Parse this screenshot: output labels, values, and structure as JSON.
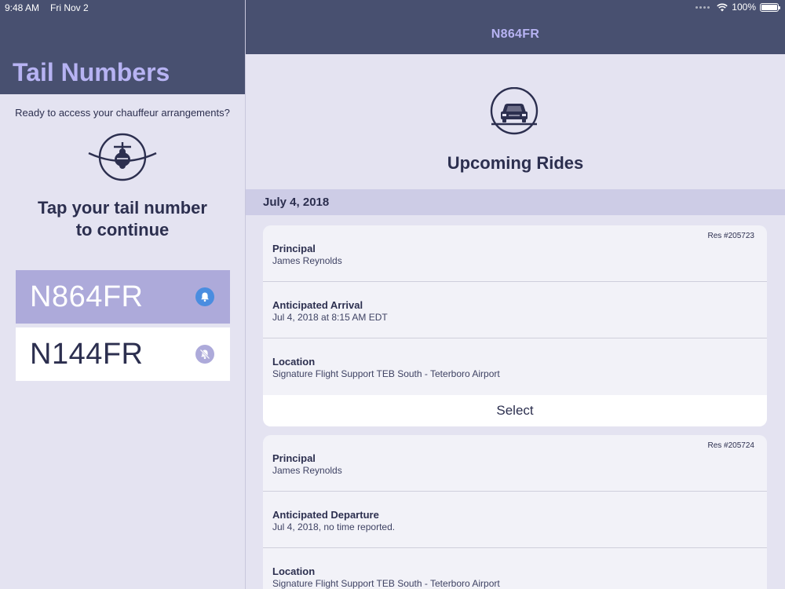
{
  "status": {
    "time": "9:48 AM",
    "date": "Fri Nov 2",
    "battery": "100%"
  },
  "sidebar": {
    "title": "Tail Numbers",
    "prompt": "Ready to access your chauffeur arrangements?",
    "tap_line1": "Tap your tail number",
    "tap_line2": "to continue",
    "items": [
      {
        "label": "N864FR",
        "icon": "bell-icon",
        "notifications": "on",
        "selected": true
      },
      {
        "label": "N144FR",
        "icon": "bell-slash-icon",
        "notifications": "off",
        "selected": false
      }
    ]
  },
  "main": {
    "title": "N864FR",
    "hero_title": "Upcoming Rides",
    "date_header": "July 4, 2018",
    "rides": [
      {
        "res": "Res #205723",
        "rows": [
          {
            "label": "Principal",
            "value": "James Reynolds"
          },
          {
            "label": "Anticipated Arrival",
            "value": "Jul 4, 2018 at 8:15 AM EDT"
          },
          {
            "label": "Location",
            "value": "Signature Flight Support TEB South - Teterboro Airport"
          }
        ],
        "action": "Select"
      },
      {
        "res": "Res #205724",
        "rows": [
          {
            "label": "Principal",
            "value": "James Reynolds"
          },
          {
            "label": "Anticipated Departure",
            "value": "Jul 4, 2018, no time reported."
          },
          {
            "label": "Location",
            "value": "Signature Flight Support TEB South - Teterboro Airport"
          }
        ]
      }
    ]
  },
  "colors": {
    "header": "#485070",
    "accent": "#b7b3f3",
    "selected": "#adaada",
    "bell_on": "#4a8de0",
    "background": "#e4e3f1"
  }
}
